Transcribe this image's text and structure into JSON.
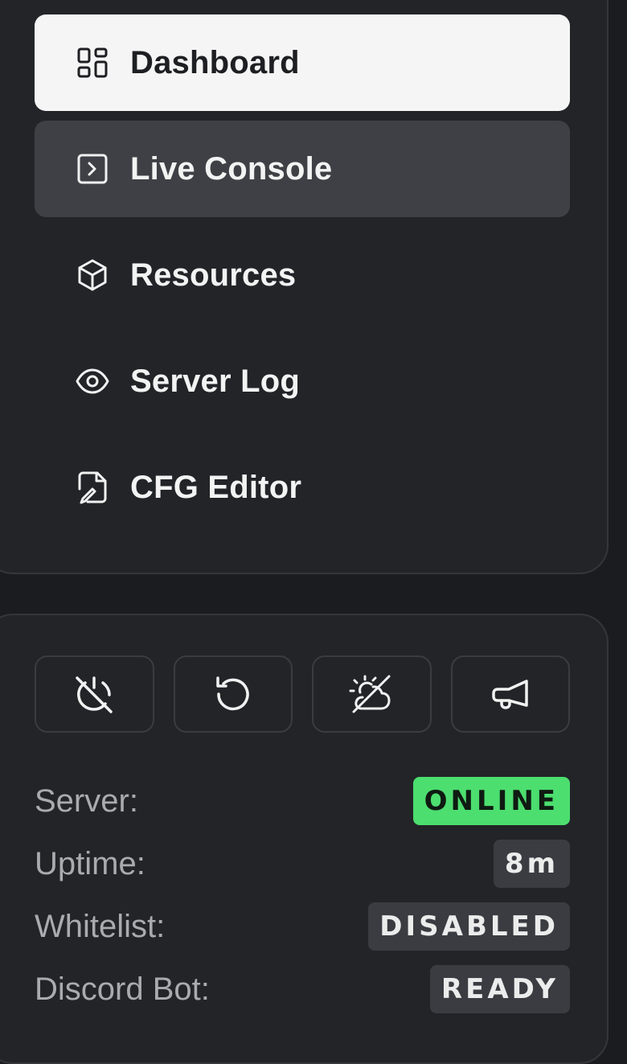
{
  "nav": {
    "items": [
      {
        "label": "Dashboard",
        "icon": "dashboard-grid-icon",
        "state": "active"
      },
      {
        "label": "Live Console",
        "icon": "terminal-icon",
        "state": "hover"
      },
      {
        "label": "Resources",
        "icon": "cube-icon",
        "state": "default"
      },
      {
        "label": "Server Log",
        "icon": "eye-icon",
        "state": "default"
      },
      {
        "label": "CFG Editor",
        "icon": "file-edit-icon",
        "state": "default"
      }
    ]
  },
  "actions": [
    {
      "name": "power-off-button",
      "icon": "power-off-icon"
    },
    {
      "name": "restart-button",
      "icon": "restart-icon"
    },
    {
      "name": "no-weather-button",
      "icon": "cloud-sun-off-icon"
    },
    {
      "name": "announce-button",
      "icon": "megaphone-icon"
    }
  ],
  "status": {
    "server_label": "Server:",
    "server_value": "ONLINE",
    "uptime_label": "Uptime:",
    "uptime_value": "8m",
    "whitelist_label": "Whitelist:",
    "whitelist_value": "DISABLED",
    "discord_label": "Discord Bot:",
    "discord_value": "READY"
  },
  "colors": {
    "background": "#1b1c1f",
    "panel": "#222428",
    "active_item": "#f5f5f5",
    "hover_item": "#3f4045",
    "online_badge": "#4cde6f",
    "badge": "#3a3c41"
  }
}
